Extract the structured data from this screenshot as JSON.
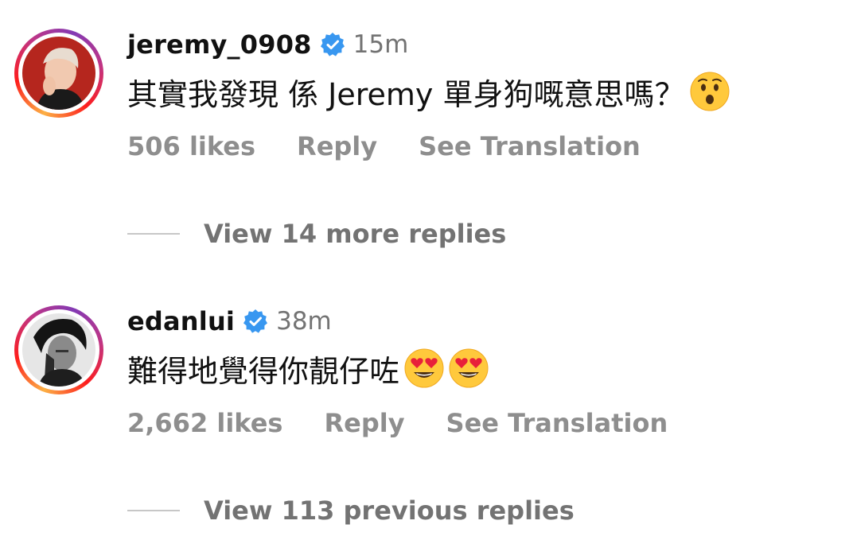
{
  "comments": [
    {
      "username": "jeremy_0908",
      "verified": true,
      "time": "15m",
      "text": "其實我發現 係 Jeremy 單身狗嘅意思嗎？",
      "emojis": [
        "hushed-face"
      ],
      "likes": "506 likes",
      "reply_label": "Reply",
      "translate_label": "See Translation",
      "replies_label": "View 14 more replies"
    },
    {
      "username": "edanlui",
      "verified": true,
      "time": "38m",
      "text": "難得地覺得你靚仔咗",
      "emojis": [
        "heart-eyes-face",
        "heart-eyes-face"
      ],
      "likes": "2,662 likes",
      "reply_label": "Reply",
      "translate_label": "See Translation",
      "replies_label": "View 113 previous replies"
    }
  ],
  "colors": {
    "verified_blue": "#3897f0",
    "secondary_text": "#8e8e8e",
    "story_ring": [
      "#fcb045",
      "#fd1d1d",
      "#c13584",
      "#833ab4"
    ]
  }
}
